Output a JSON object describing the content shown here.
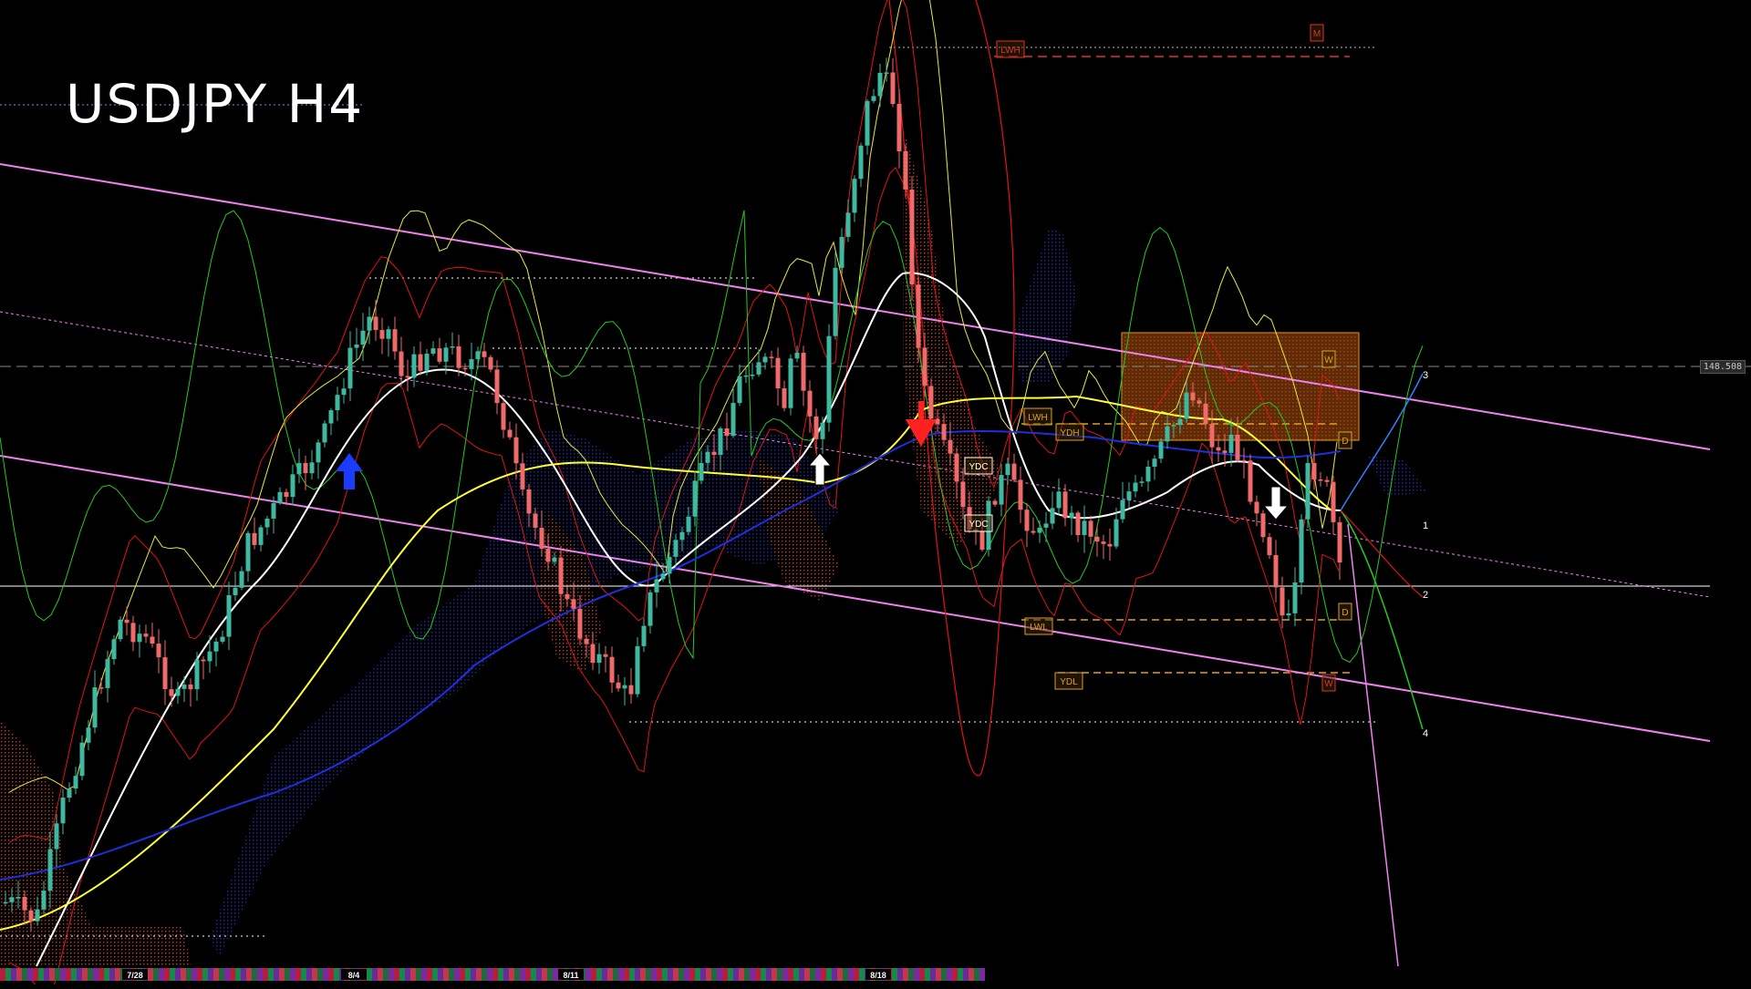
{
  "chart_data": {
    "type": "candlestick",
    "title": "USDJPY H4",
    "symbol": "USDJPY",
    "timeframe": "H4",
    "price_label": "148.508",
    "date_labels": [
      "7/28",
      "8/4",
      "8/11",
      "8/18"
    ],
    "level_labels": [
      "LWH",
      "M",
      "LWH",
      "YDH",
      "YDC",
      "YDC",
      "LWL",
      "YDL",
      "W",
      "W",
      "D",
      "D"
    ],
    "projection_labels": [
      "3",
      "1",
      "2",
      "4"
    ],
    "colors": {
      "background": "#000000",
      "bull_candle": "#3fb8a0",
      "bear_candle": "#f06a6a",
      "channel": "#ee82ee",
      "ma_white": "#ffffff",
      "ma_yellow": "#ffff33",
      "ma_blue": "#1f2fdc",
      "bollinger": "#e01515",
      "oscillator": "#22cc22",
      "cloud_blue": "#1a2fae",
      "cloud_red": "#c23a1a",
      "zone_orange": "#e0a020"
    },
    "indicators": [
      "candles",
      "moving averages",
      "bollinger bands",
      "ichimoku cloud",
      "trend channel",
      "signal arrows",
      "pivot levels"
    ]
  }
}
